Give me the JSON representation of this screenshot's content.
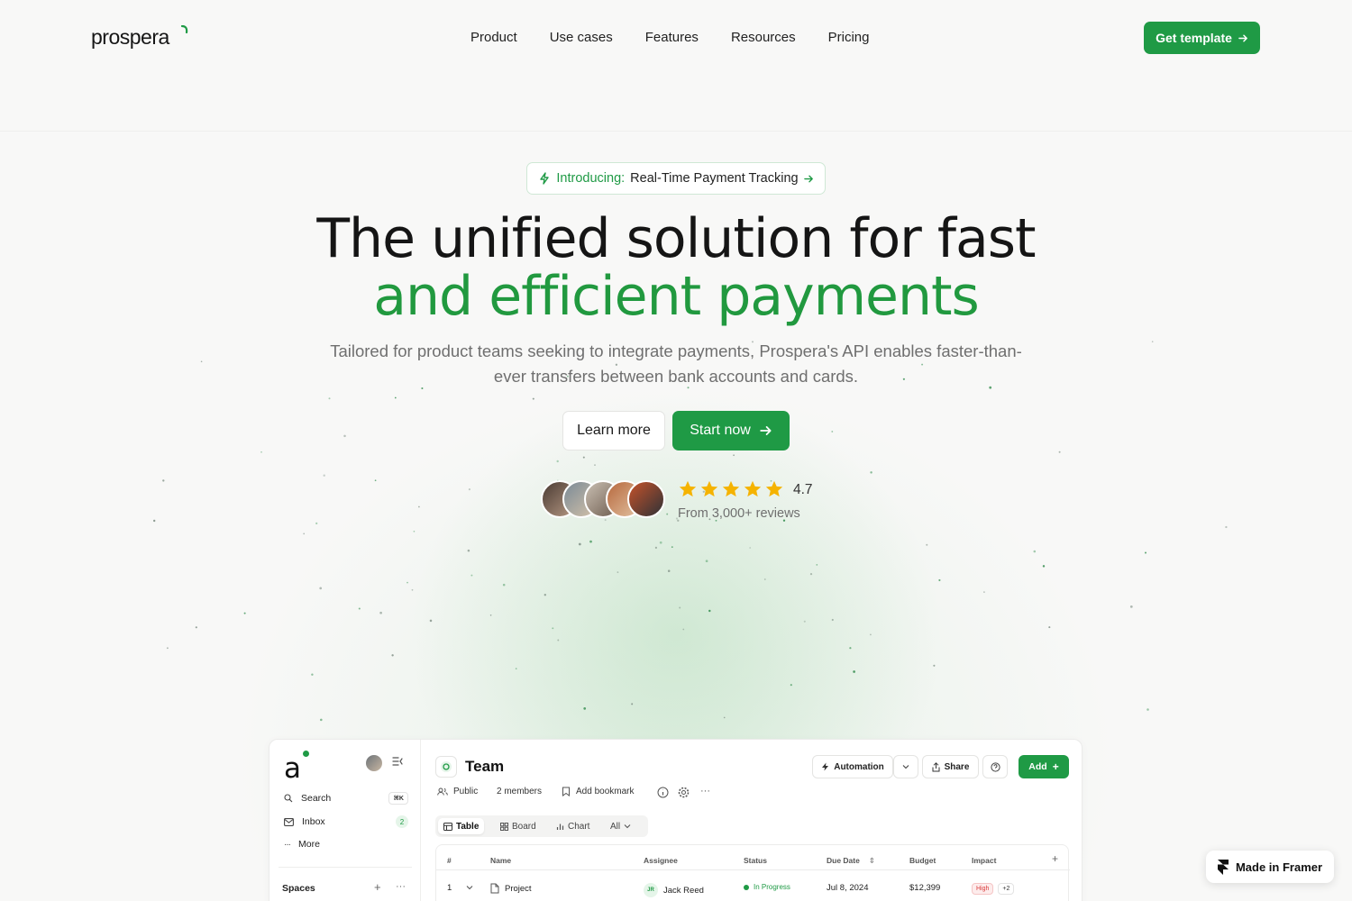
{
  "brand": {
    "name": "prospera",
    "accent": "#1f9a45"
  },
  "nav": {
    "links": [
      "Product",
      "Use cases",
      "Features",
      "Resources",
      "Pricing"
    ],
    "cta_label": "Get template"
  },
  "hero": {
    "badge_intro": "Introducing:",
    "badge_text": "Real-Time Payment Tracking",
    "headline_line1": "The unified solution for fast",
    "headline_line2": "and efficient payments",
    "subtitle": "Tailored for product teams seeking to integrate payments, Prospera's API enables faster-than-ever transfers between bank accounts and cards.",
    "learn_more_label": "Learn more",
    "start_now_label": "Start now",
    "rating_value": "4.7",
    "rating_stars": 5,
    "reviews_text": "From 3,000+ reviews"
  },
  "app_preview": {
    "sidebar": {
      "logo_letter": "a",
      "search_label": "Search",
      "search_shortcut": "⌘K",
      "inbox_label": "Inbox",
      "inbox_count": "2",
      "more_label": "More",
      "spaces_label": "Spaces"
    },
    "header": {
      "title": "Team",
      "visibility": "Public",
      "members": "2 members",
      "bookmark_label": "Add bookmark",
      "automation_label": "Automation",
      "share_label": "Share",
      "add_label": "Add"
    },
    "views": {
      "table": "Table",
      "board": "Board",
      "chart": "Chart",
      "filter": "All"
    },
    "table": {
      "columns": [
        "#",
        "Name",
        "Assignee",
        "Status",
        "Due Date",
        "Budget",
        "Impact"
      ],
      "rows": [
        {
          "index": "1",
          "name": "Project",
          "assignee_initials": "JR",
          "assignee": "Jack Reed",
          "status": "In Progress",
          "due_date": "Jul 8, 2024",
          "budget": "$12,399",
          "impact": "High",
          "impact_extra": "+2"
        }
      ]
    }
  },
  "framer_badge": "Made in Framer"
}
